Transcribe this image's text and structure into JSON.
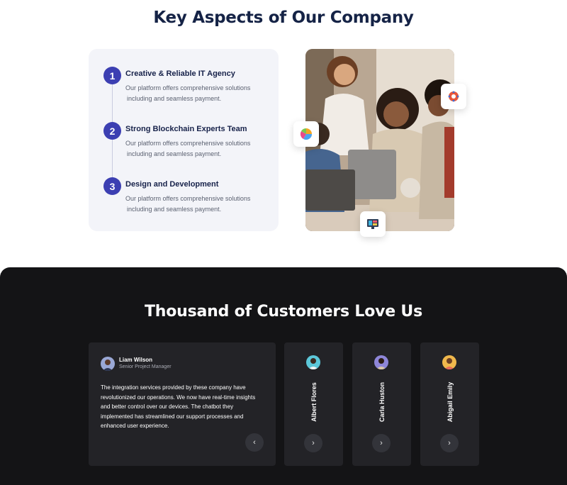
{
  "aspects": {
    "title": "Key Aspects of Our Company",
    "steps": [
      {
        "number": "1",
        "title": "Creative & Reliable IT Agency",
        "desc_line1": "Our platform offers comprehensive solutions",
        "desc_line2": "including  and seamless payment."
      },
      {
        "number": "2",
        "title": "Strong Blockchain Experts Team",
        "desc_line1": "Our platform offers comprehensive solutions",
        "desc_line2": "including  and seamless payment."
      },
      {
        "number": "3",
        "title": "Design and Development",
        "desc_line1": "Our platform offers comprehensive solutions",
        "desc_line2": "including  and seamless payment."
      }
    ],
    "badges": [
      "pie-chart-icon",
      "gear-icon",
      "monitor-icon"
    ]
  },
  "testimonials": {
    "title": "Thousand of Customers Love Us",
    "active": {
      "name": "Liam Wilson",
      "role": "Senior Project Manager",
      "quote": "The integration services provided by these company have revolutionized our operations. We now have real-time insights and better control over our devices. The chatbot they implemented has streamlined our support processes and enhanced user experience.",
      "prev_icon": "‹"
    },
    "collapsed": [
      {
        "name": "Albert Flores",
        "next_icon": "›"
      },
      {
        "name": "Carla Huston",
        "next_icon": "›"
      },
      {
        "name": "Abigail Emily",
        "next_icon": "›"
      }
    ]
  },
  "colors": {
    "heading": "#152346",
    "accent": "#3c3fb2",
    "dark_bg": "#141416",
    "card_bg": "#232327"
  }
}
